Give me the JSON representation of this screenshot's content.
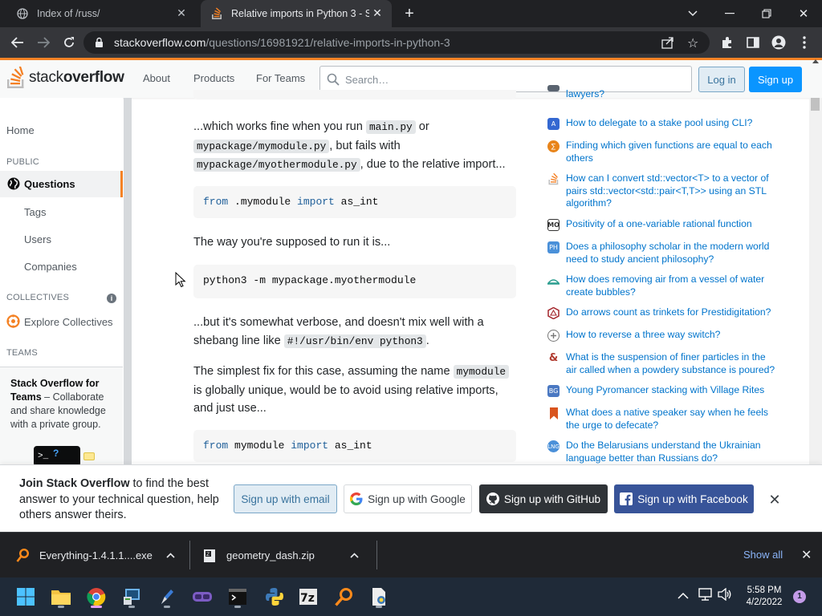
{
  "browser": {
    "tabs": [
      {
        "title": "Index of /russ/",
        "active": false
      },
      {
        "title": "Relative imports in Python 3 - Stack Overflow",
        "active": true
      }
    ],
    "url_host": "stackoverflow.com",
    "url_path": "/questions/16981921/relative-imports-in-python-3"
  },
  "header": {
    "logo_text_light": "stack",
    "logo_text_bold": "overflow",
    "nav": [
      "About",
      "Products",
      "For Teams"
    ],
    "search_placeholder": "Search…",
    "login_label": "Log in",
    "signup_label": "Sign up"
  },
  "sidebar": {
    "home": "Home",
    "public_header": "PUBLIC",
    "questions": "Questions",
    "tags": "Tags",
    "users": "Users",
    "companies": "Companies",
    "collectives_header": "COLLECTIVES",
    "explore_collectives": "Explore Collectives",
    "teams_header": "TEAMS",
    "teams_title": "Stack Overflow for Teams",
    "teams_text": " – Collaborate and share knowledge with a private group."
  },
  "answer": {
    "p1_a": "...which works fine when you run ",
    "p1_code1": "main.py",
    "p1_b": " or ",
    "p1_code2": "mypackage/mymodule.py",
    "p1_c": ", but fails with ",
    "p1_code3": "mypackage/myothermodule.py",
    "p1_d": ", due to the relative import...",
    "code1_kw1": "from",
    "code1_mid": " .mymodule ",
    "code1_kw2": "import",
    "code1_end": " as_int",
    "p2": "The way you're supposed to run it is...",
    "code2": "python3 -m mypackage.myothermodule",
    "p3_a": "...but it's somewhat verbose, and doesn't mix well with a shebang line like ",
    "p3_code": "#!/usr/bin/env python3",
    "p3_b": ".",
    "p4_a": "The simplest fix for this case, assuming the name ",
    "p4_code": "mymodule",
    "p4_b": " is globally unique, would be to avoid using relative imports, and just use...",
    "code3_kw1": "from",
    "code3_mid": " mymodule ",
    "code3_kw2": "import",
    "code3_end": " as_int"
  },
  "hot_questions": [
    {
      "title": "lawyers?",
      "icon": "law-icon",
      "color": "#5a6470"
    },
    {
      "title": "How to delegate to a stake pool using CLI?",
      "icon": "cardano-icon",
      "color": "#3468d1"
    },
    {
      "title": "Finding which given functions are equal to each others",
      "icon": "math-icon",
      "color": "#e8841a"
    },
    {
      "title": "How can I convert std::vector<T> to a vector of pairs std::vector<std::pair<T,T>> using an STL algorithm?",
      "icon": "stackoverflow-icon",
      "color": "#f48225"
    },
    {
      "title": "Positivity of a one-variable rational function",
      "icon": "mathoverflow-icon",
      "color": "#333333"
    },
    {
      "title": "Does a philosophy scholar in the modern world need to study ancient philosophy?",
      "icon": "philosophy-icon",
      "color": "#4a90d9"
    },
    {
      "title": "How does removing air from a vessel of water create bubbles?",
      "icon": "physics-icon",
      "color": "#2a9d8f"
    },
    {
      "title": "Do arrows count as trinkets for Prestidigitation?",
      "icon": "rpg-icon",
      "color": "#a4262c"
    },
    {
      "title": "How to reverse a three way switch?",
      "icon": "diy-icon",
      "color": "#777777"
    },
    {
      "title": "What is the suspension of finer particles in the air called when a powdery substance is poured?",
      "icon": "english-icon",
      "color": "#b03a2e"
    },
    {
      "title": "Young Pyromancer stacking with Village Rites",
      "icon": "boardgames-icon",
      "color": "#4a78c2"
    },
    {
      "title": "What does a native speaker say when he feels the urge to defecate?",
      "icon": "bookmark-icon",
      "color": "#d9541e"
    },
    {
      "title": "Do the Belarusians understand the Ukrainian language better than Russians do?",
      "icon": "linguistics-icon",
      "color": "#4a90d9"
    }
  ],
  "banner": {
    "bold": "Join Stack Overflow",
    "rest": " to find the best answer to your technical question, help others answer theirs.",
    "email": "Sign up with email",
    "google": "Sign up with Google",
    "github": "Sign up with GitHub",
    "facebook": "Sign up with Facebook"
  },
  "downloads": {
    "items": [
      "Everything-1.4.1.1....exe",
      "geometry_dash.zip"
    ],
    "show_all": "Show all"
  },
  "taskbar": {
    "time": "5:58 PM",
    "date": "4/2/2022",
    "notification_count": "1"
  }
}
